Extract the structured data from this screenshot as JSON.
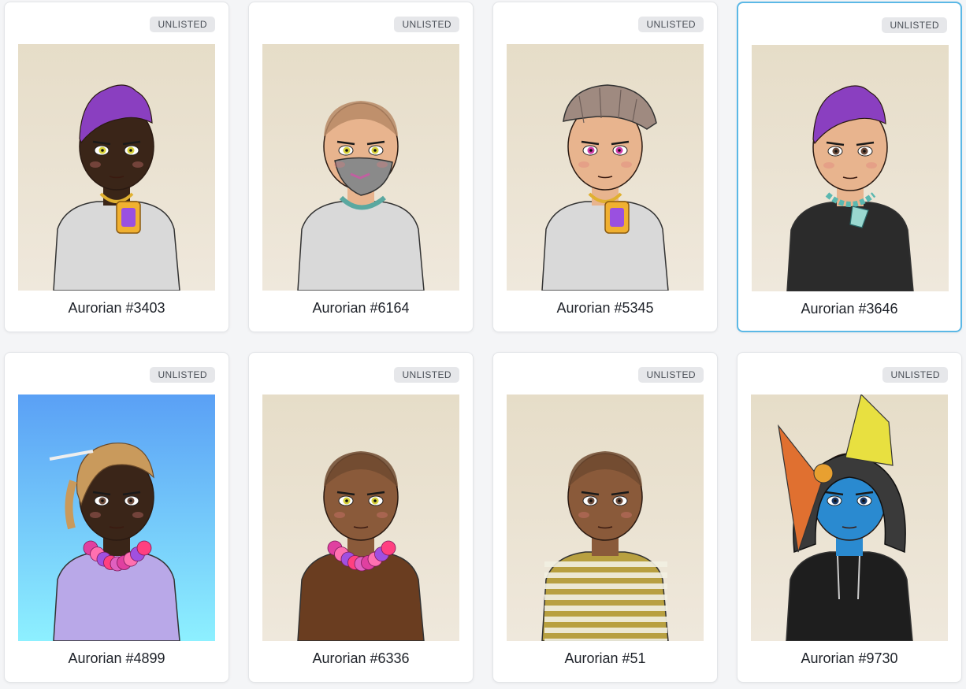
{
  "cards": [
    {
      "name": "Aurorian #3403",
      "badge": "UNLISTED",
      "bg": [
        "#e6ddc8",
        "#efe8dc"
      ],
      "skin": "#3a2518",
      "hair": "#8a3fc0",
      "hair_style": "mohawk",
      "eyes": "#d8d23a",
      "shirt": "#d9d9d9",
      "accessory": "gold-chain",
      "selected": false
    },
    {
      "name": "Aurorian #6164",
      "badge": "UNLISTED",
      "bg": [
        "#e6ddc8",
        "#efe8dc"
      ],
      "skin": "#e8b48e",
      "hair": "#b78a66",
      "hair_style": "shaved",
      "eyes": "#d8d23a",
      "shirt": "#d9d9d9",
      "accessory": "mask",
      "selected": false
    },
    {
      "name": "Aurorian #5345",
      "badge": "UNLISTED",
      "bg": [
        "#e6ddc8",
        "#efe8dc"
      ],
      "skin": "#e8b48e",
      "hair": "#9f8a80",
      "hair_style": "cap",
      "eyes": "#d03aa8",
      "shirt": "#d9d9d9",
      "accessory": "gold-chain",
      "selected": false
    },
    {
      "name": "Aurorian #3646",
      "badge": "UNLISTED",
      "bg": [
        "#e6ddc8",
        "#efe8dc"
      ],
      "skin": "#e8b48e",
      "hair": "#8a3fc0",
      "hair_style": "mohawk",
      "eyes": "#6a4a3a",
      "shirt": "#2b2b2b",
      "accessory": "teal-necklace",
      "selected": true
    },
    {
      "name": "Aurorian #4899",
      "badge": "UNLISTED",
      "bg": [
        "#5aa0f5",
        "#8df0ff"
      ],
      "skin": "#3a2518",
      "hair": "#c99a5c",
      "hair_style": "braids",
      "eyes": "#6a4a3a",
      "shirt": "#b9a8e8",
      "accessory": "flower-lei",
      "selected": false
    },
    {
      "name": "Aurorian #6336",
      "badge": "UNLISTED",
      "bg": [
        "#e6ddc8",
        "#efe8dc"
      ],
      "skin": "#8a5a3a",
      "hair": "#6f4a30",
      "hair_style": "shaved",
      "eyes": "#d8d23a",
      "shirt": "#6a3d20",
      "accessory": "flower-lei",
      "selected": false
    },
    {
      "name": "Aurorian #51",
      "badge": "UNLISTED",
      "bg": [
        "#e6ddc8",
        "#efe8dc"
      ],
      "skin": "#8a5a3a",
      "hair": "#6f4a30",
      "hair_style": "shaved",
      "eyes": "#6a4a3a",
      "shirt": "#b8a040",
      "accessory": "stripes",
      "selected": false
    },
    {
      "name": "Aurorian #9730",
      "badge": "UNLISTED",
      "bg": [
        "#e6ddc8",
        "#efe8dc"
      ],
      "skin": "#2a8ad0",
      "hair": "#3a3a3a",
      "hair_style": "hood",
      "eyes": "#1a3a6a",
      "shirt": "#1e1e1e",
      "accessory": "hoodie",
      "selected": false
    }
  ]
}
